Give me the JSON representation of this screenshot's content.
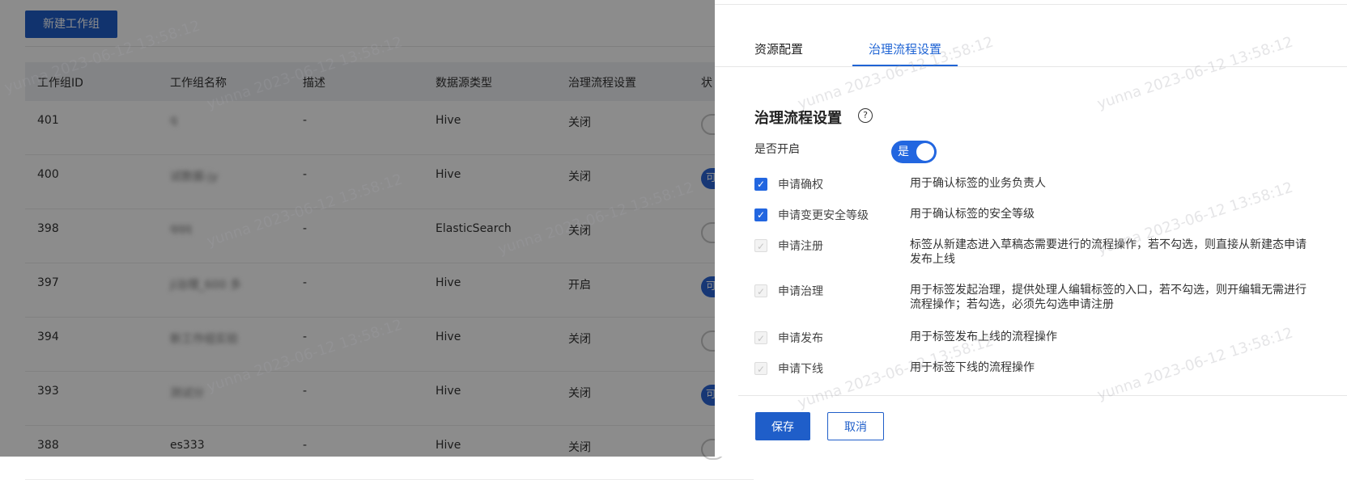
{
  "background": {
    "new_button": "新建工作组",
    "columns": [
      "工作组ID",
      "工作组名称",
      "描述",
      "数据源类型",
      "治理流程设置",
      "状"
    ],
    "rows": [
      {
        "id": "401",
        "name": "q",
        "desc": "-",
        "type": "Hive",
        "flow": "关闭",
        "status": "off"
      },
      {
        "id": "400",
        "name": "试数据-jy",
        "desc": "-",
        "type": "Hive",
        "flow": "关闭",
        "status": "可"
      },
      {
        "id": "398",
        "name": "qqq",
        "desc": "-",
        "type": "ElasticSearch",
        "flow": "关闭",
        "status": "off"
      },
      {
        "id": "397",
        "name": "ji治理_600 多",
        "desc": "-",
        "type": "Hive",
        "flow": "开启",
        "status": "可"
      },
      {
        "id": "394",
        "name": "新工作组实验",
        "desc": "-",
        "type": "Hive",
        "flow": "关闭",
        "status": "off"
      },
      {
        "id": "393",
        "name": "测试分",
        "desc": "-",
        "type": "Hive",
        "flow": "关闭",
        "status": "可"
      },
      {
        "id": "388",
        "name": "es333",
        "desc": "-",
        "type": "Hive",
        "flow": "关闭",
        "status": "off"
      }
    ]
  },
  "drawer": {
    "tabs": [
      {
        "label": "资源配置",
        "active": false
      },
      {
        "label": "治理流程设置",
        "active": true
      }
    ],
    "section_title": "治理流程设置",
    "help_icon": "question-circle-icon",
    "enable_label": "是否开启",
    "enable_switch_text": "是",
    "enable_switch_on": true,
    "options": [
      {
        "label": "申请确权",
        "desc": "用于确认标签的业务负责人",
        "checked": true,
        "disabled": false
      },
      {
        "label": "申请变更安全等级",
        "desc": "用于确认标签的安全等级",
        "checked": true,
        "disabled": false
      },
      {
        "label": "申请注册",
        "desc": "标签从新建态进入草稿态需要进行的流程操作，若不勾选，则直接从新建态申请发布上线",
        "checked": true,
        "disabled": true
      },
      {
        "label": "申请治理",
        "desc": "用于标签发起治理，提供处理人编辑标签的入口，若不勾选，则开编辑无需进行流程操作；若勾选，必须先勾选申请注册",
        "checked": true,
        "disabled": true
      },
      {
        "label": "申请发布",
        "desc": "用于标签发布上线的流程操作",
        "checked": true,
        "disabled": true
      },
      {
        "label": "申请下线",
        "desc": "用于标签下线的流程操作",
        "checked": true,
        "disabled": true
      }
    ],
    "save_label": "保存",
    "cancel_label": "取消"
  },
  "watermark": "yunna 2023-06-12 13:58:12",
  "colors": {
    "primary": "#1f5ec9",
    "switch": "#2266e0",
    "overlay": "rgba(0,0,0,0.45)"
  }
}
